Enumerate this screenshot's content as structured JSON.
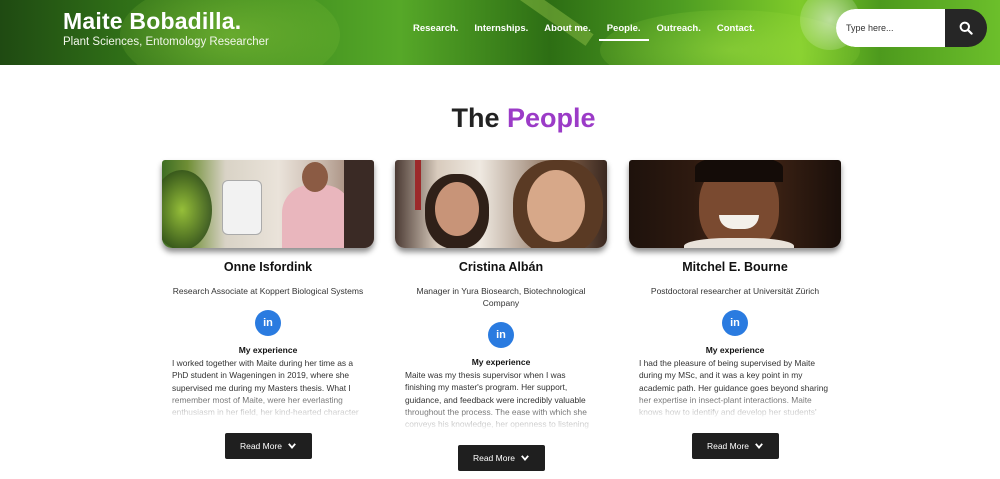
{
  "header": {
    "title": "Maite Bobadilla.",
    "subtitle": "Plant Sciences, Entomology Researcher",
    "nav": [
      "Research.",
      "Internships.",
      "About me.",
      "People.",
      "Outreach.",
      "Contact."
    ],
    "active_nav": "People.",
    "search_placeholder": "Type here..."
  },
  "section": {
    "title_plain": "The",
    "title_accent": "People",
    "accent_color": "#9b3bc7"
  },
  "people": [
    {
      "name": "Onne Isfordink",
      "role": "Research Associate at Koppert Biological Systems",
      "linkedin": "in",
      "experience_heading": "My experience",
      "experience": "I worked together with Maite during her time as a PhD student in Wageningen in 2019, where she supervised me during my Masters thesis. What I remember most of Maite, were her everlasting enthusiasm in her field, her kind-hearted character",
      "read_more": "Read More"
    },
    {
      "name": "Cristina Albán",
      "role": "Manager in Yura Biosearch, Biotechnological Company",
      "linkedin": "in",
      "experience_heading": "My experience",
      "experience": "Maite was my thesis supervisor when I was finishing my master's program. Her support, guidance, and feedback were incredibly valuable throughout the process. The ease with which she conveys his knowledge, her openness to listening",
      "read_more": "Read More"
    },
    {
      "name": "Mitchel E. Bourne",
      "role": "Postdoctoral researcher at Universität Zürich",
      "linkedin": "in",
      "experience_heading": "My experience",
      "experience": "I had the pleasure of being supervised by Maite during my MSc, and it was a key point in my academic path. Her guidance goes beyond sharing her expertise in insect-plant interactions. Maite knows how to identify and develop her students'",
      "read_more": "Read More"
    }
  ],
  "colors": {
    "linkedin": "#2a7be0",
    "button": "#1f1f1f",
    "search_button": "#262626"
  }
}
